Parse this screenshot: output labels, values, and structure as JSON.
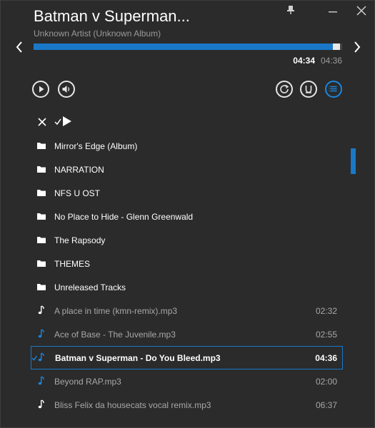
{
  "window": {
    "title": "Batman v Superman...",
    "subtitle": "Unknown Artist (Unknown Album)"
  },
  "player": {
    "current_time": "04:34",
    "total_time": "04:36",
    "progress": 0.992
  },
  "icons": {
    "pin": "pin-icon",
    "minimize": "minimize-icon",
    "close": "close-icon",
    "prev": "chevron-left-icon",
    "next": "chevron-right-icon",
    "play": "play-icon",
    "volume": "volume-icon",
    "repeat": "repeat-icon",
    "shuffle": "shuffle-icon",
    "playlist": "playlist-icon",
    "folder": "folder-icon",
    "note": "music-note-icon"
  },
  "colors": {
    "accent": "#1a78c8",
    "background": "#2b2b2b",
    "text_dim": "#a8a8a8"
  },
  "list": [
    {
      "type": "folder",
      "name": "Mirror's Edge (Album)",
      "duration": ""
    },
    {
      "type": "folder",
      "name": "NARRATION",
      "duration": ""
    },
    {
      "type": "folder",
      "name": "NFS U OST",
      "duration": ""
    },
    {
      "type": "folder",
      "name": "No Place to Hide - Glenn Greenwald",
      "duration": ""
    },
    {
      "type": "folder",
      "name": "The Rapsody",
      "duration": ""
    },
    {
      "type": "folder",
      "name": "THEMES",
      "duration": ""
    },
    {
      "type": "folder",
      "name": "Unreleased Tracks",
      "duration": ""
    },
    {
      "type": "file",
      "name": "A place in time (kmn-remix).mp3",
      "duration": "02:32",
      "note_color": "white"
    },
    {
      "type": "file",
      "name": "Ace of Base - The Juvenile.mp3",
      "duration": "02:55",
      "note_color": "blue"
    },
    {
      "type": "file",
      "name": "Batman v Superman - Do You Bleed.mp3",
      "duration": "04:36",
      "note_color": "blue",
      "selected": true
    },
    {
      "type": "file",
      "name": "Beyond RAP.mp3",
      "duration": "02:00",
      "note_color": "blue"
    },
    {
      "type": "file",
      "name": "Bliss Felix da housecats vocal remix.mp3",
      "duration": "06:37",
      "note_color": "white"
    }
  ]
}
